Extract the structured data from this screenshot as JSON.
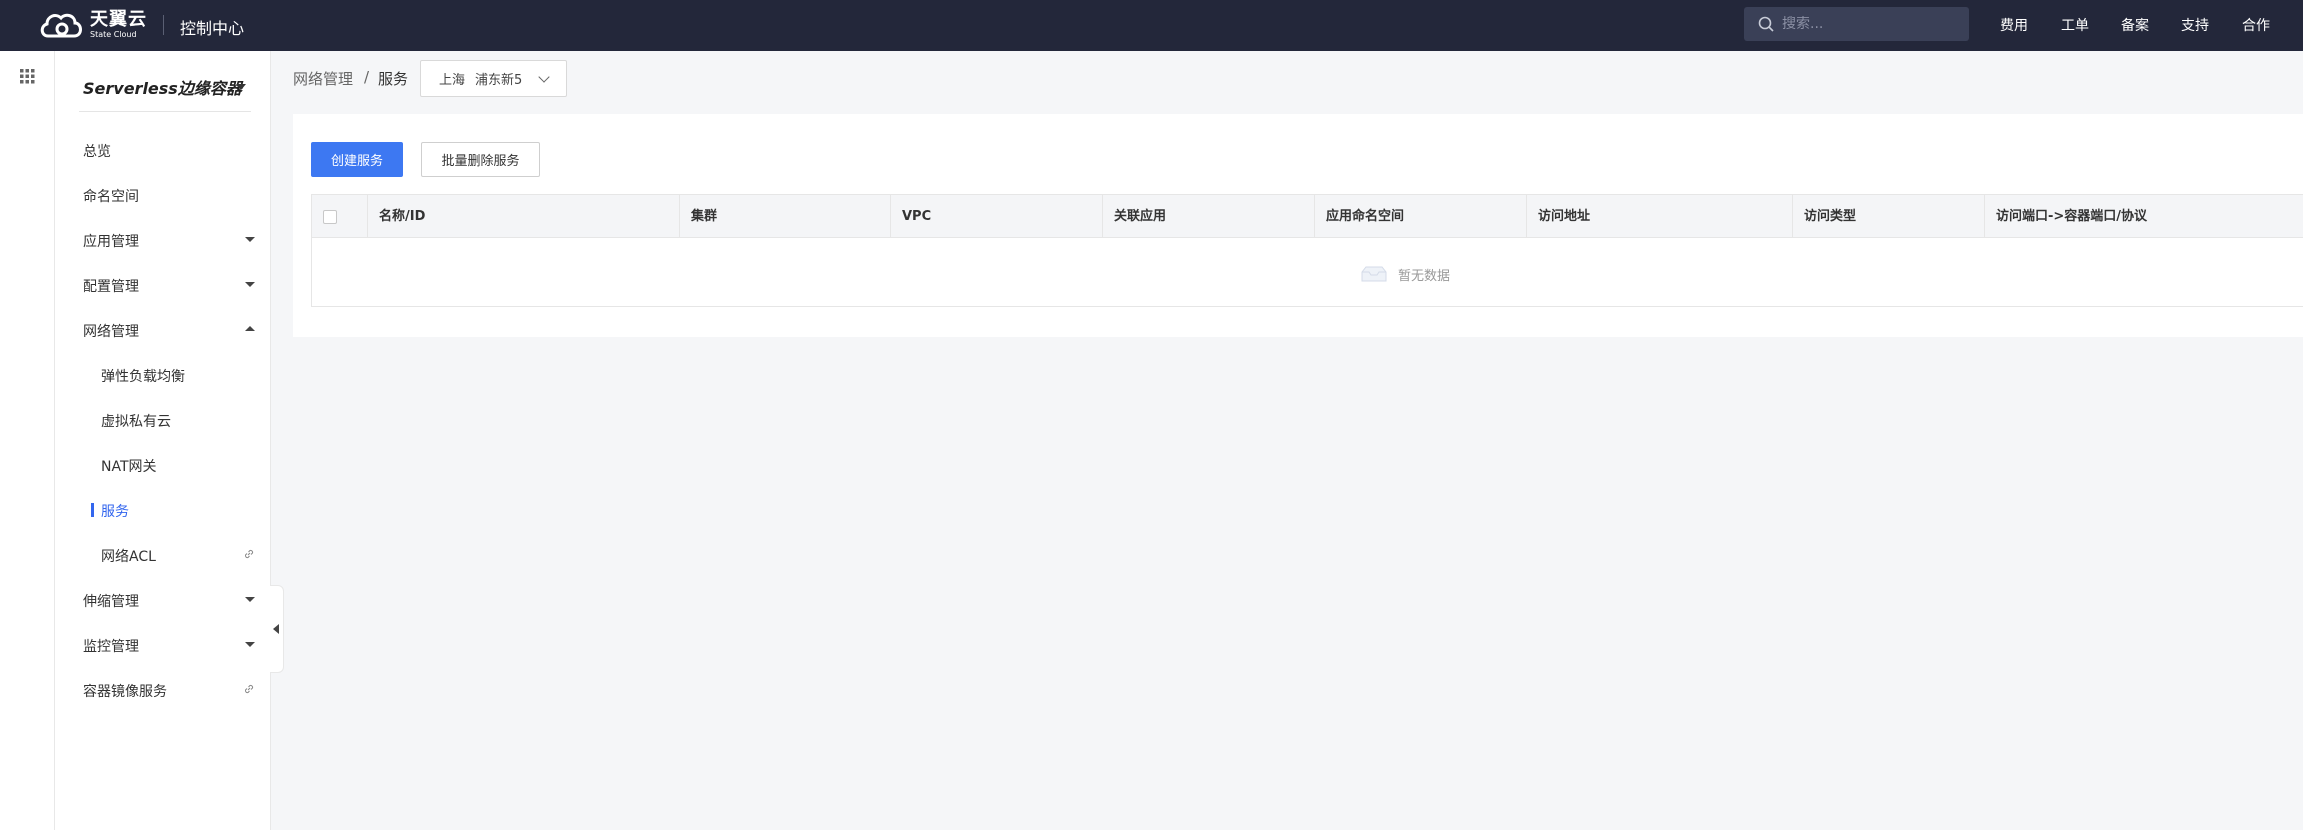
{
  "header": {
    "logo_cn": "天翼云",
    "logo_en": "State Cloud",
    "console_title": "控制中心",
    "search_placeholder": "搜索...",
    "nav": [
      "费用",
      "工单",
      "备案",
      "支持",
      "合作"
    ]
  },
  "sidebar": {
    "title": "Serverless边缘容器",
    "items": [
      {
        "label": "总览"
      },
      {
        "label": "命名空间"
      },
      {
        "label": "应用管理"
      },
      {
        "label": "配置管理"
      },
      {
        "label": "网络管理"
      },
      {
        "label": "弹性负载均衡"
      },
      {
        "label": "虚拟私有云"
      },
      {
        "label": "NAT网关"
      },
      {
        "label": "服务"
      },
      {
        "label": "网络ACL"
      },
      {
        "label": "伸缩管理"
      },
      {
        "label": "监控管理"
      },
      {
        "label": "容器镜像服务"
      }
    ]
  },
  "breadcrumb": {
    "parent": "网络管理",
    "separator": "/",
    "current": "服务"
  },
  "region": {
    "city": "上海",
    "zone": "浦东新5"
  },
  "toolbar": {
    "create_label": "创建服务",
    "batch_delete_label": "批量删除服务"
  },
  "table": {
    "columns": [
      "名称/ID",
      "集群",
      "VPC",
      "关联应用",
      "应用命名空间",
      "访问地址",
      "访问类型",
      "访问端口->容器端口/协议"
    ],
    "empty_text": "暂无数据"
  },
  "colors": {
    "topbar": "#23273a",
    "primary": "#3d78f2",
    "active_menu": "#3366ee"
  }
}
